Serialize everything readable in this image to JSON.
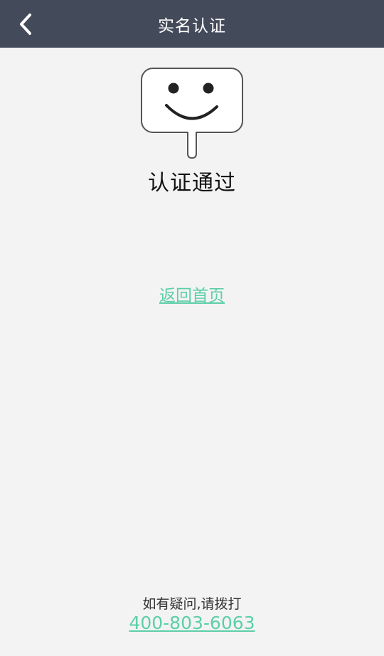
{
  "header": {
    "title": "实名认证",
    "back_icon": "chevron-left-icon",
    "background_color": "#434a5a"
  },
  "result": {
    "icon": "smiley-sign-icon",
    "title": "认证通过"
  },
  "actions": {
    "home_link": "返回首页"
  },
  "footer": {
    "note": "如有疑问,请拨打",
    "phone": "400-803-6063"
  },
  "colors": {
    "accent": "#5ccfa8",
    "background": "#f3f3f3"
  }
}
